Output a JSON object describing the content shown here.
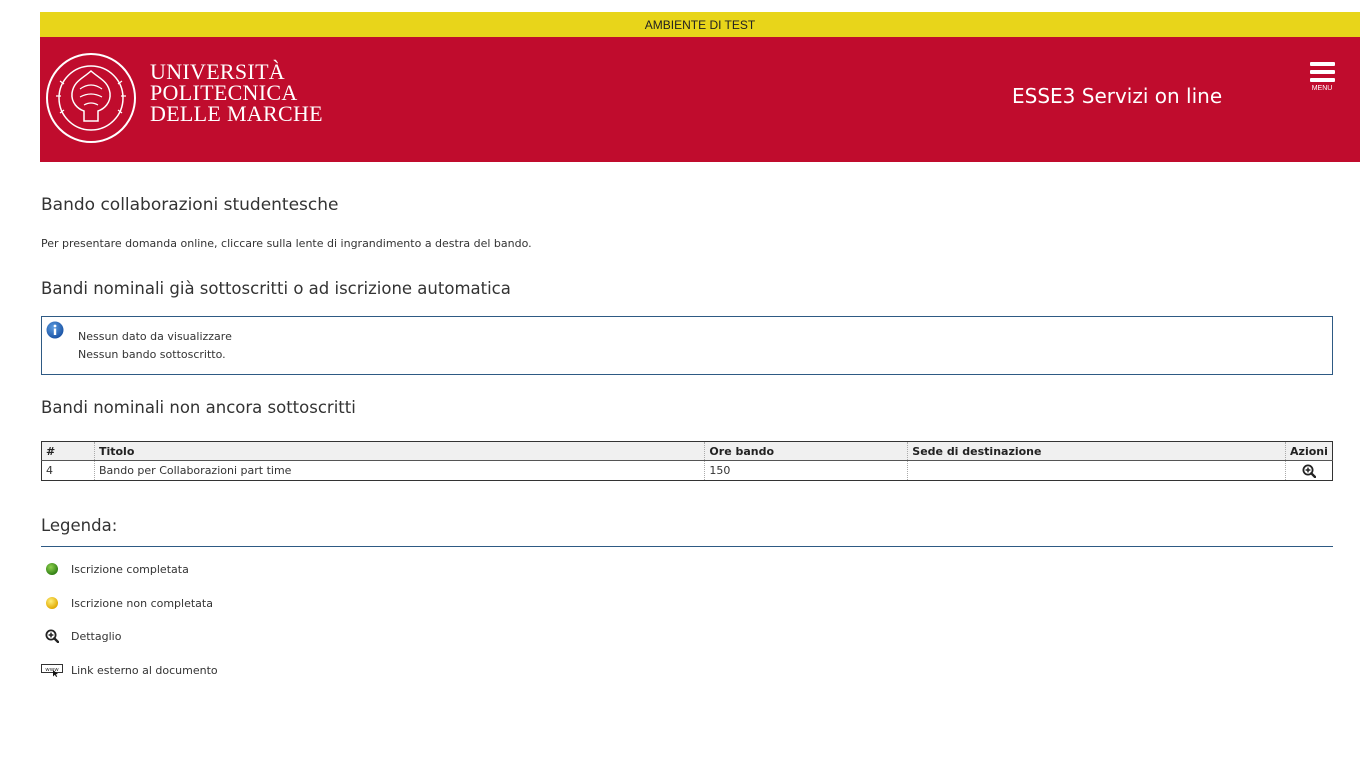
{
  "banner": {
    "text": "AMBIENTE DI TEST"
  },
  "header": {
    "university_line1": "UNIVERSITÀ",
    "university_line2": "POLITECNICA",
    "university_line3": "DELLE MARCHE",
    "service_title": "ESSE3 Servizi on line",
    "menu_label": "MENU"
  },
  "page": {
    "title": "Bando collaborazioni studentesche",
    "intro": "Per presentare domanda online, cliccare sulla lente di ingrandimento a destra del bando."
  },
  "subscribed_section": {
    "title": "Bandi nominali già sottoscritti o ad iscrizione automatica",
    "info_line1": "Nessun dato da visualizzare",
    "info_line2": "Nessun bando sottoscritto."
  },
  "unsubscribed_section": {
    "title": "Bandi nominali non ancora sottoscritti",
    "columns": [
      "#",
      "Titolo",
      "Ore bando",
      "Sede di destinazione",
      "Azioni"
    ],
    "rows": [
      {
        "num": "4",
        "titolo": "Bando per Collaborazioni part time",
        "ore": "150",
        "sede": "",
        "action_icon": "zoom-in-icon"
      }
    ]
  },
  "legend": {
    "title": "Legenda:",
    "items": [
      {
        "icon": "green-dot-icon",
        "label": "Iscrizione completata"
      },
      {
        "icon": "yellow-dot-icon",
        "label": "Iscrizione non completata"
      },
      {
        "icon": "zoom-in-icon",
        "label": "Dettaglio"
      },
      {
        "icon": "www-link-icon",
        "label": "Link esterno al documento"
      }
    ]
  },
  "colors": {
    "header_red": "#c00c2d",
    "banner_yellow": "#e8d51a",
    "rule_blue": "#2e5a84"
  }
}
